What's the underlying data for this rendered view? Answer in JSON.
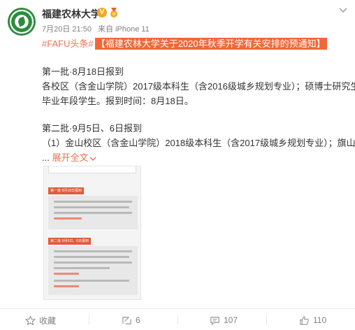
{
  "header": {
    "nickname": "福建农林大学",
    "verified_color": "#f5a623",
    "time": "7月20日 21:50",
    "source": "来自 iPhone 11",
    "menu_icon": "chevron-down-icon"
  },
  "post": {
    "hashtag": "#FAFU头条#",
    "headline": "【福建农林大学关于2020年秋季开学有关安排的预通知】",
    "paragraph1": [
      "第一批·8月18日报到",
      "各校区（含金山学院）2017级本科生（含2016级城乡规划专业）；硕博士研究生",
      "毕业年段学生。报到时间：8月18日。"
    ],
    "paragraph2": [
      "第二批·9月5日、6日报到",
      "（1）金山校区（含金山学院）2018级本科生（含2017级城乡规划专业）；旗山"
    ],
    "ellipsis": "...",
    "expand_label": "展开全文",
    "expand_icon": "chevron-down-icon",
    "accent_color": "#eb7350",
    "headline_bg": "#f0683a"
  },
  "image": {
    "header1": "第一批·8月18日报到",
    "header2": "第二批·9月5日、6日报到"
  },
  "actions": {
    "favorite": {
      "label": "收藏",
      "icon": "star-icon"
    },
    "repost": {
      "label": "6",
      "icon": "repost-icon"
    },
    "comment": {
      "label": "107",
      "icon": "comment-icon"
    },
    "like": {
      "label": "110",
      "icon": "thumbs-up-icon"
    }
  }
}
